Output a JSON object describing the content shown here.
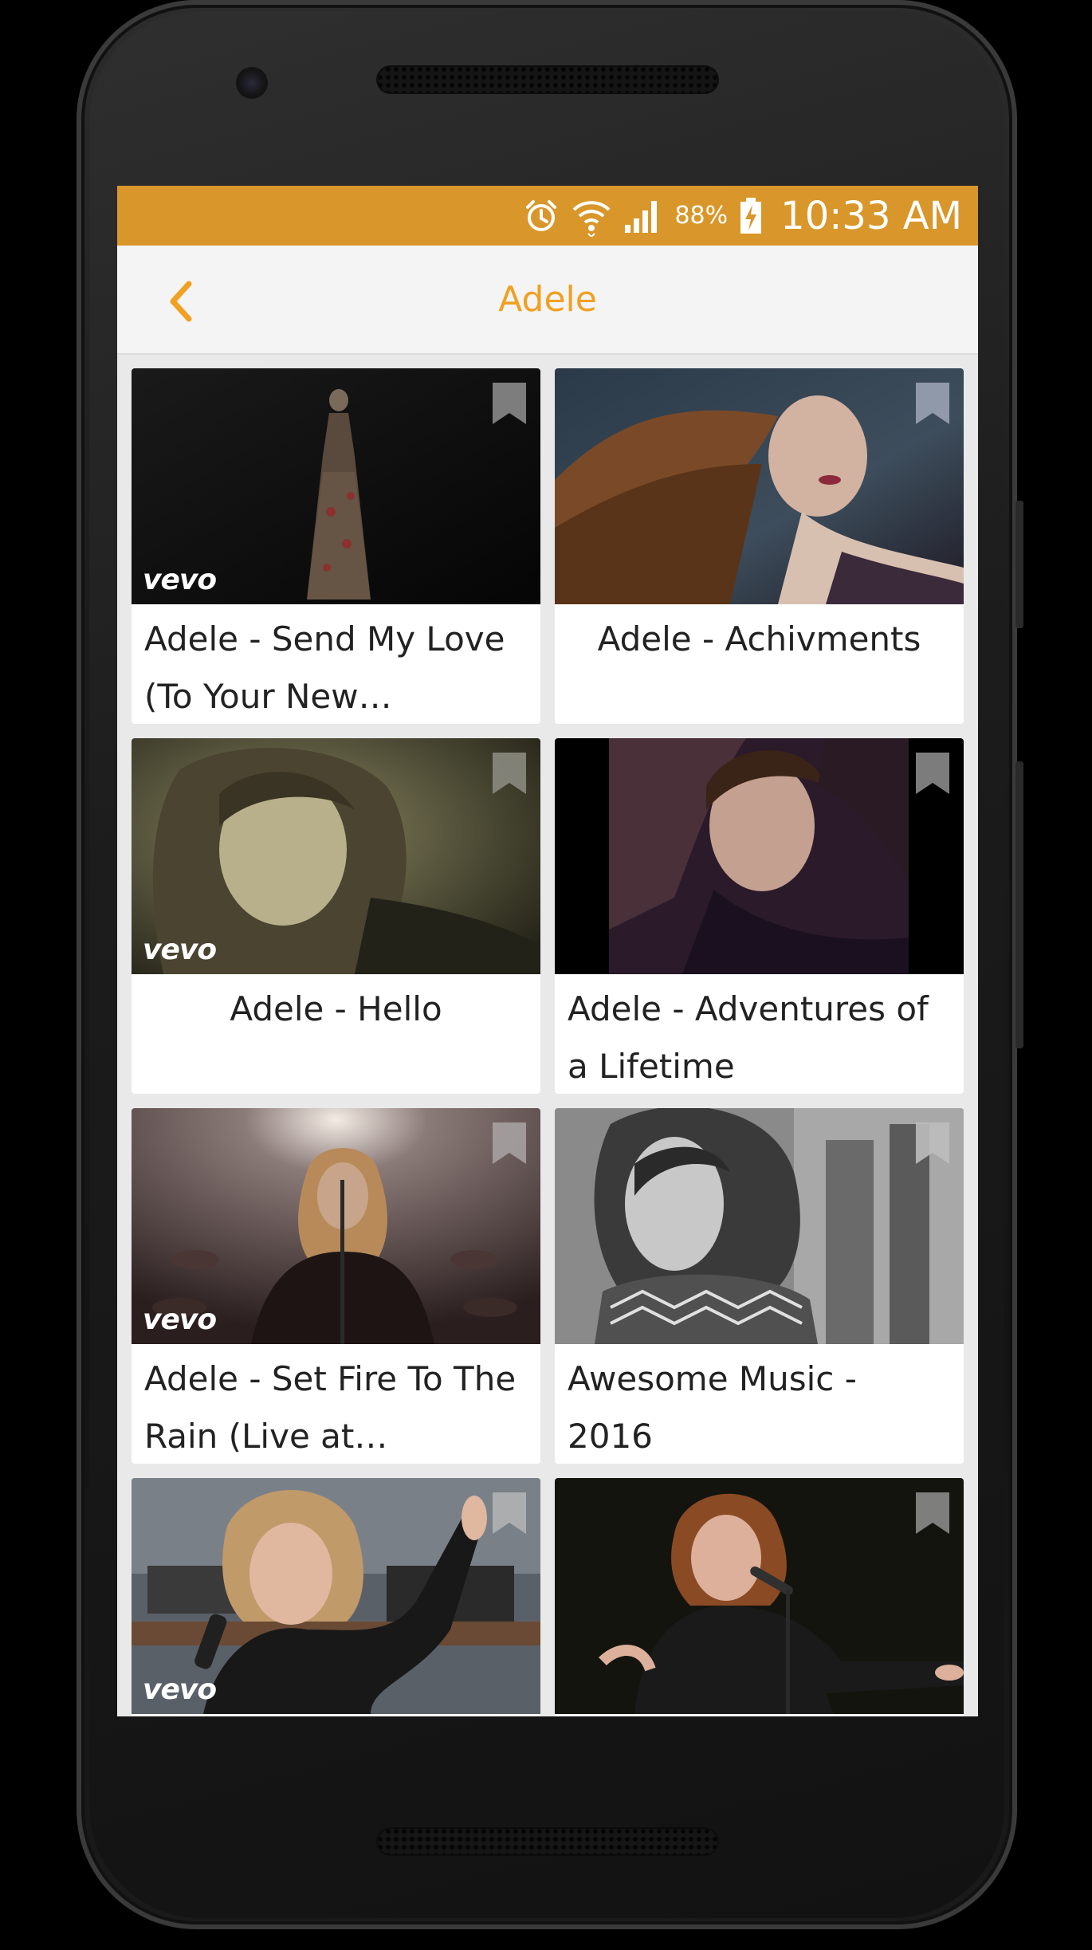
{
  "status_bar": {
    "battery_percent": "88%",
    "time": "10:33 AM",
    "background_color": "#d9962a",
    "icons": [
      "alarm-icon",
      "wifi-icon",
      "signal-icon",
      "battery-charging-icon"
    ]
  },
  "app_bar": {
    "title": "Adele",
    "back_icon": "chevron-left-icon",
    "accent_color": "#f0a022"
  },
  "videos": [
    {
      "title": "Adele - Send My Love (To Your New…",
      "vevo": "vevo",
      "bookmark_icon": "bookmark-icon"
    },
    {
      "title": "Adele - Achivments",
      "vevo": "",
      "bookmark_icon": "bookmark-icon"
    },
    {
      "title": "Adele - Hello",
      "vevo": "vevo",
      "bookmark_icon": "bookmark-icon"
    },
    {
      "title": "Adele - Adventures of a Lifetime",
      "vevo": "",
      "bookmark_icon": "bookmark-icon"
    },
    {
      "title": "Adele - Set Fire To The Rain (Live at…",
      "vevo": "vevo",
      "bookmark_icon": "bookmark-icon"
    },
    {
      "title": "Awesome Music - 2016",
      "vevo": "",
      "bookmark_icon": "bookmark-icon"
    },
    {
      "title": "",
      "vevo": "vevo",
      "bookmark_icon": "bookmark-icon"
    },
    {
      "title": "",
      "vevo": "",
      "bookmark_icon": "bookmark-icon"
    }
  ]
}
